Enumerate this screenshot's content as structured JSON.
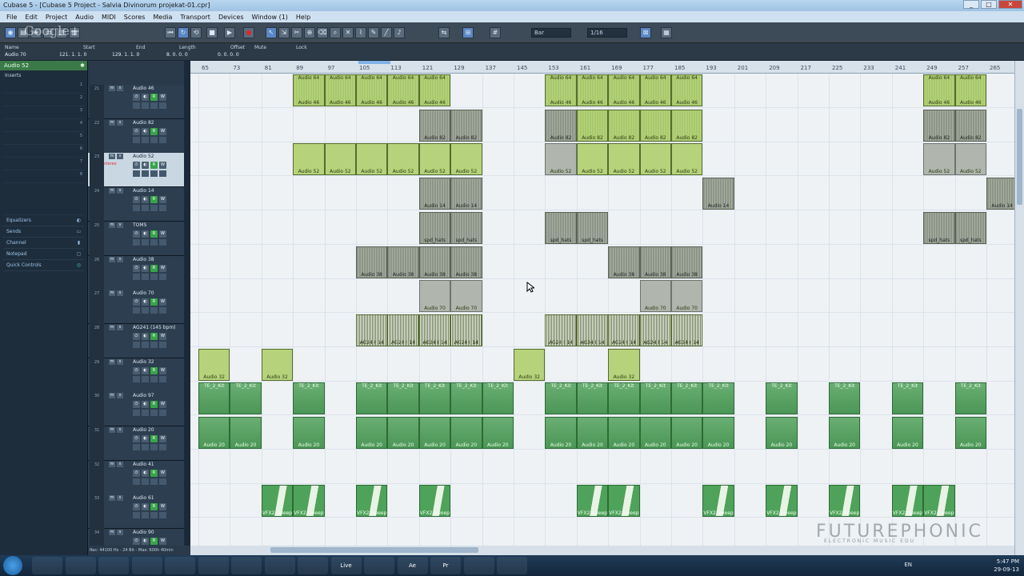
{
  "window": {
    "title": "Cubase 5 - [Cubase 5 Project - Salvia Divinorum projekat-01.cpr]",
    "controls": [
      "_",
      "□",
      "✕"
    ]
  },
  "menu": [
    "File",
    "Edit",
    "Project",
    "Audio",
    "MIDI",
    "Scores",
    "Media",
    "Transport",
    "Devices",
    "Window (1)",
    "Help"
  ],
  "toolbar": {
    "grid_label": "Bar",
    "quantize_label": "1/16"
  },
  "infoline": {
    "headers": [
      "Name",
      "Start",
      "End",
      "Length",
      "Offset",
      "Mute",
      "Lock"
    ],
    "values": [
      "Audio 70",
      "121. 1. 1. 0",
      "129. 1. 1. 0",
      "8. 0. 0. 0",
      "0. 0. 0. 0",
      "",
      ""
    ]
  },
  "inspector": {
    "title": "Audio 52",
    "inserts_label": "Inserts",
    "slot_numbers": [
      "1",
      "2",
      "3",
      "4",
      "5",
      "6",
      "7",
      "8"
    ],
    "sections": [
      "Equalizers",
      "Sends",
      "Channel",
      "Notepad",
      "Quick Controls"
    ]
  },
  "tracks": [
    {
      "num": "21",
      "name": "Audio 46"
    },
    {
      "num": "22",
      "name": "Audio 82"
    },
    {
      "num": "23",
      "name": "Audio 52",
      "sub": "stereo",
      "selected": true
    },
    {
      "num": "24",
      "name": "Audio 14"
    },
    {
      "num": "25",
      "name": "TOMS"
    },
    {
      "num": "26",
      "name": "Audio 38"
    },
    {
      "num": "27",
      "name": "Audio 70"
    },
    {
      "num": "28",
      "name": "AG241 (145 bpm)"
    },
    {
      "num": "29",
      "name": "Audio 32"
    },
    {
      "num": "30",
      "name": "Audio 97"
    },
    {
      "num": "31",
      "name": "Audio 20"
    },
    {
      "num": "32",
      "name": "Audio 41"
    },
    {
      "num": "33",
      "name": "Audio 61"
    },
    {
      "num": "34",
      "name": "Audio 90"
    }
  ],
  "ruler": [
    "65",
    "73",
    "81",
    "89",
    "97",
    "105",
    "113",
    "121",
    "129",
    "137",
    "145",
    "153",
    "161",
    "169",
    "177",
    "185",
    "193",
    "201",
    "209",
    "217",
    "225",
    "233",
    "241",
    "249",
    "257",
    "265"
  ],
  "events": {
    "top_row": [
      "Audio 64",
      "Audio 64",
      "Audio 64",
      "Audio 64",
      "Audio 64",
      "Audio 64",
      "Audio 64",
      "Audio 64",
      "Audio 64",
      "Audio 64",
      "Audio 64"
    ],
    "a46": "Audio 46",
    "a82": "Audio 82",
    "a52": "Audio 52",
    "a14": "Audio 14",
    "spd": "spd_hats",
    "a38": "Audio 38",
    "a70": "Audio 70",
    "ag": "AG24 ( 14",
    "a32": "Audio 32",
    "te": "TE_2_Kit",
    "a20": "Audio 20",
    "vfx": "VFX2 Sweeps Long",
    "vfx_short": "VFX2 Sw"
  },
  "status": "Rec: 44100 Hz - 24 Bit - Max: 600h 40min",
  "watermark": {
    "main": "FUTUREPHONIC",
    "sub": "ELECTRONIC MUSIC EDU"
  },
  "google_overlay": "Google+",
  "taskbar": {
    "lang": "EN",
    "time": "5:47 PM",
    "date": "29-09-13",
    "apps": [
      "",
      "",
      "",
      "",
      "",
      "",
      "",
      "",
      "",
      "Live",
      "",
      "Ae",
      "Pr",
      "",
      ""
    ]
  }
}
